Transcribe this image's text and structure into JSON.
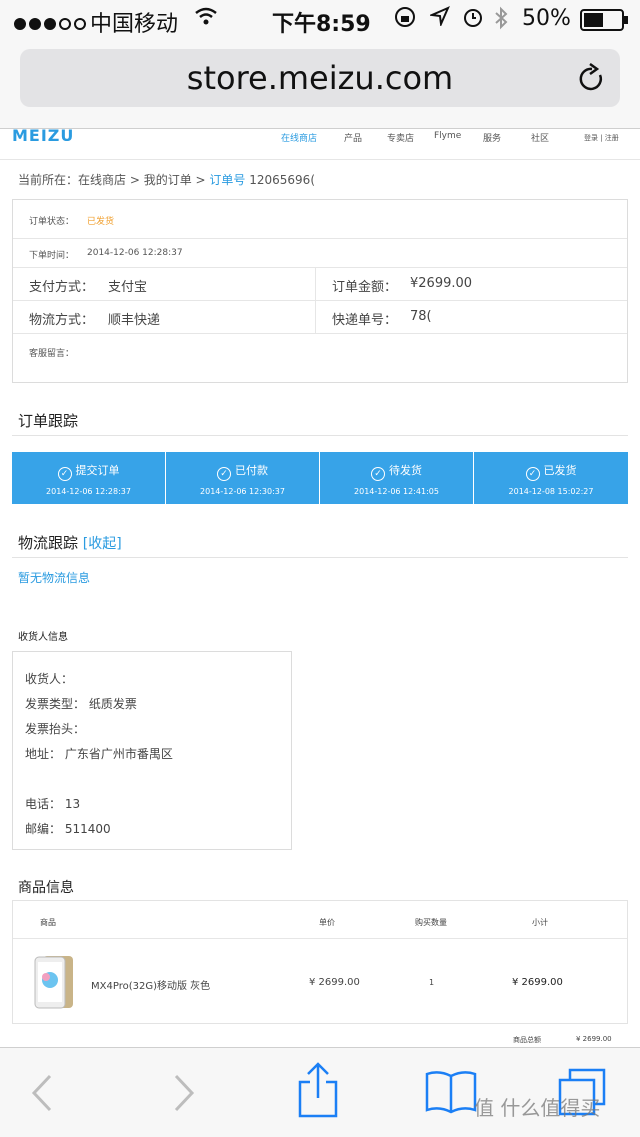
{
  "status_bar": {
    "carrier": "中国移动",
    "time": "下午8:59",
    "battery": "50%"
  },
  "browser": {
    "url": "store.meizu.com"
  },
  "site_nav": {
    "logo": "MEIZU",
    "items": [
      "在线商店",
      "产品",
      "专卖店",
      "Flyme",
      "服务",
      "社区"
    ],
    "account": "登录 | 注册"
  },
  "breadcrumb": {
    "prefix": "当前所在：",
    "path": "在线商店 > 我的订单 > ",
    "current_label": "订单号",
    "order_no": "12065696("
  },
  "order_info": {
    "status_label": "订单状态：",
    "status_value": "已发货",
    "time_label": "下单时间：",
    "time_value": "2014-12-06 12:28:37",
    "pay_label": "支付方式：",
    "pay_value": "支付宝",
    "amount_label": "订单金额：",
    "amount_value": "¥2699.00",
    "ship_label": "物流方式：",
    "ship_value": "顺丰快递",
    "tracking_label": "快递单号：",
    "tracking_value": "78(",
    "message_label": "客服留言："
  },
  "order_tracking": {
    "title": "订单跟踪",
    "steps": [
      {
        "label": "提交订单",
        "time": "2014-12-06 12:28:37"
      },
      {
        "label": "已付款",
        "time": "2014-12-06 12:30:37"
      },
      {
        "label": "待发货",
        "time": "2014-12-06 12:41:05"
      },
      {
        "label": "已发货",
        "time": "2014-12-08 15:02:27"
      }
    ]
  },
  "logistics": {
    "title": "物流跟踪",
    "toggle": "[收起]",
    "empty": "暂无物流信息"
  },
  "receiver": {
    "title": "收货人信息",
    "name": "收货人：",
    "invoice_type": "发票类型：  纸质发票",
    "invoice_title": "发票抬头：",
    "address": "地址：  广东省广州市番禺区",
    "phone": "电话：  13",
    "zip": "邮编：  511400"
  },
  "products": {
    "title": "商品信息",
    "headers": [
      "商品",
      "单价",
      "购买数量",
      "小计"
    ],
    "rows": [
      {
        "name": "MX4Pro(32G)移动版 灰色",
        "price": "¥ 2699.00",
        "qty": "1",
        "subtotal": "¥ 2699.00"
      }
    ],
    "total_label": "商品总额",
    "total_value": "¥ 2699.00"
  },
  "watermark": "值 什么值得买",
  "colors": {
    "accent": "#2a9be0",
    "step_bg": "#37a3e8",
    "status_orange": "#f0a030"
  }
}
